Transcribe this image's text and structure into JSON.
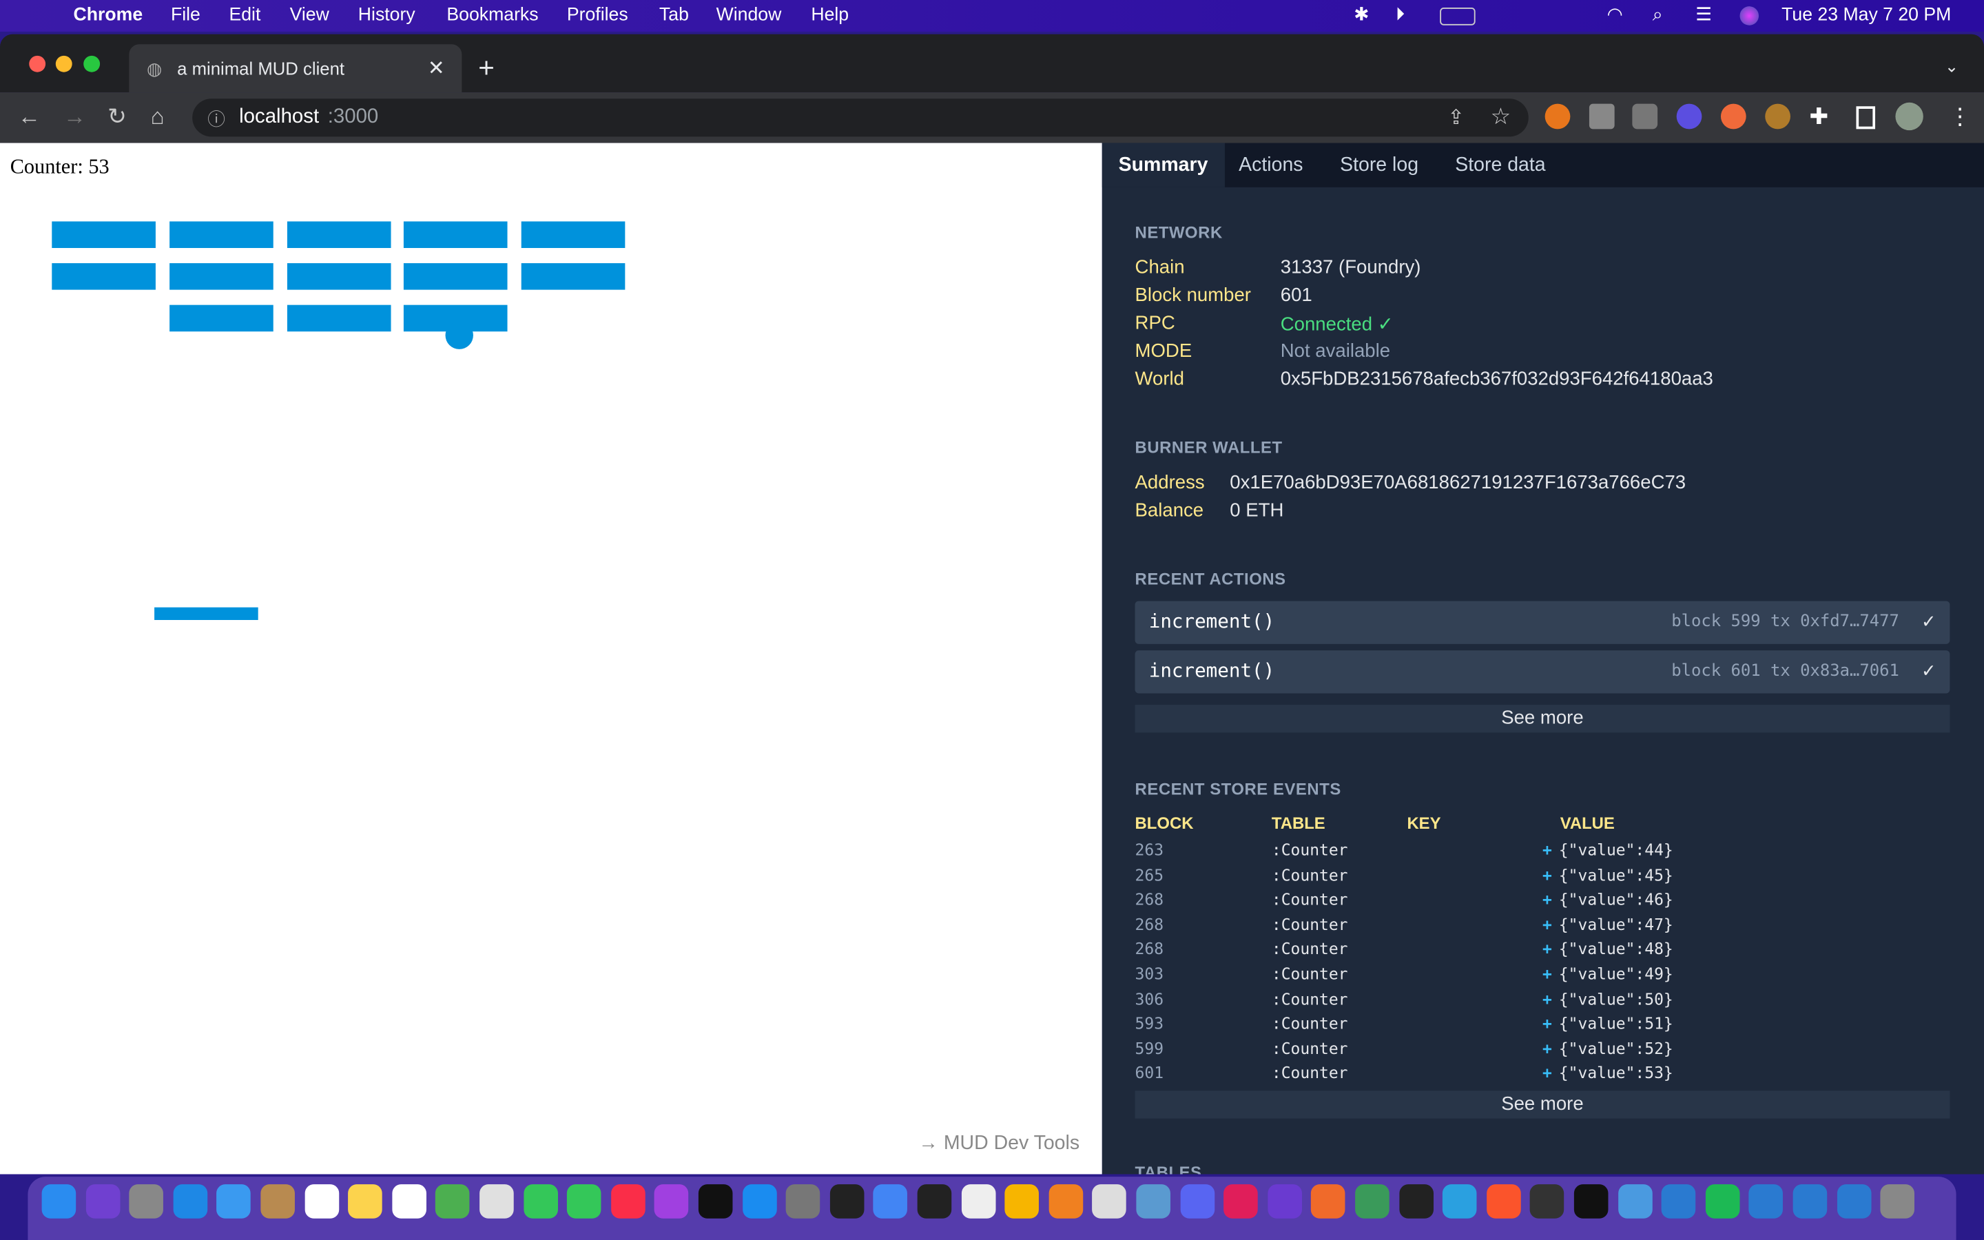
{
  "menubar": {
    "app": "Chrome",
    "items": [
      "File",
      "Edit",
      "View",
      "History",
      "Bookmarks",
      "Profiles",
      "Tab",
      "Window",
      "Help"
    ],
    "clock": "Tue 23 May  7 20 PM"
  },
  "browser": {
    "tab_title": "a minimal MUD client",
    "url_host": "localhost",
    "url_port": ":3000"
  },
  "page": {
    "counter_label": "Counter: 53",
    "devtools_link": "→ MUD Dev Tools",
    "brick_color": "#0092dc"
  },
  "devtools": {
    "tabs": [
      "Summary",
      "Actions",
      "Store log",
      "Store data"
    ],
    "network": {
      "heading": "NETWORK",
      "rows": [
        {
          "label": "Chain",
          "value": "31337 (Foundry)"
        },
        {
          "label": "Block number",
          "value": "601"
        },
        {
          "label": "RPC",
          "value": "Connected ✓"
        },
        {
          "label": "MODE",
          "value": "Not available"
        },
        {
          "label": "World",
          "value": "0x5FbDB2315678afecb367f032d93F642f64180aa3"
        }
      ]
    },
    "wallet": {
      "heading": "BURNER WALLET",
      "rows": [
        {
          "label": "Address",
          "value": "0x1E70a6bD93E70A6818627191237F1673a766eC73"
        },
        {
          "label": "Balance",
          "value": "0 ETH"
        }
      ]
    },
    "actions": {
      "heading": "RECENT ACTIONS",
      "items": [
        {
          "fn": "increment()",
          "meta": "block 599  tx 0xfd7…7477",
          "check": "✓"
        },
        {
          "fn": "increment()",
          "meta": "block 601  tx 0x83a…7061",
          "check": "✓"
        }
      ],
      "see_more": "See more"
    },
    "events": {
      "heading": "RECENT STORE EVENTS",
      "columns": [
        "BLOCK",
        "TABLE",
        "KEY",
        "VALUE"
      ],
      "rows": [
        {
          "block": "263",
          "table": ":Counter",
          "key": "",
          "op": "+",
          "value": "{\"value\":44}"
        },
        {
          "block": "265",
          "table": ":Counter",
          "key": "",
          "op": "+",
          "value": "{\"value\":45}"
        },
        {
          "block": "268",
          "table": ":Counter",
          "key": "",
          "op": "+",
          "value": "{\"value\":46}"
        },
        {
          "block": "268",
          "table": ":Counter",
          "key": "",
          "op": "+",
          "value": "{\"value\":47}"
        },
        {
          "block": "268",
          "table": ":Counter",
          "key": "",
          "op": "+",
          "value": "{\"value\":48}"
        },
        {
          "block": "303",
          "table": ":Counter",
          "key": "",
          "op": "+",
          "value": "{\"value\":49}"
        },
        {
          "block": "306",
          "table": ":Counter",
          "key": "",
          "op": "+",
          "value": "{\"value\":50}"
        },
        {
          "block": "593",
          "table": ":Counter",
          "key": "",
          "op": "+",
          "value": "{\"value\":51}"
        },
        {
          "block": "599",
          "table": ":Counter",
          "key": "",
          "op": "+",
          "value": "{\"value\":52}"
        },
        {
          "block": "601",
          "table": ":Counter",
          "key": "",
          "op": "+",
          "value": "{\"value\":53}"
        }
      ],
      "see_more": "See more"
    },
    "tables_heading": "TABLES"
  }
}
